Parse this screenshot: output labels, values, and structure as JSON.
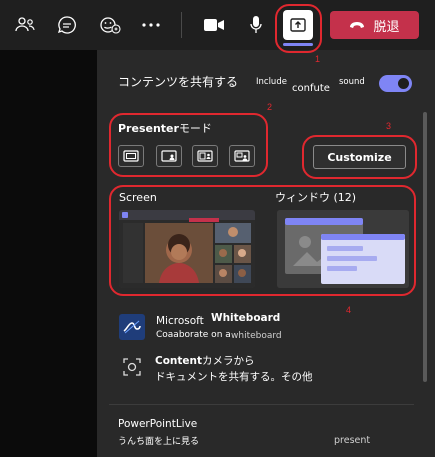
{
  "toolbar": {
    "icons": [
      "people-icon",
      "chat-icon",
      "react-icon",
      "more-icon",
      "camera-icon",
      "mic-icon",
      "share-tray-icon"
    ],
    "leave_label": "脱退"
  },
  "annotations": {
    "n1": "1",
    "n2": "2",
    "n3": "3",
    "n4": "4"
  },
  "share": {
    "heading": "コンテンツを共有する",
    "include_label": "Include",
    "include_sub": "confute",
    "sound_label": "sound",
    "sound_on": true,
    "presenter_bold": "Presenter",
    "presenter_mode": "モード",
    "presenter_modes": [
      "content-only",
      "standout",
      "side-by-side",
      "reporter"
    ],
    "customize_label": "Customize",
    "screen_label": "Screen",
    "window_label": "ウィンドウ (12)",
    "whiteboard_app": "Microsoft",
    "whiteboard_name": "Whiteboard",
    "whiteboard_sub_a": "Coaaborate on a",
    "whiteboard_sub_b": "whiteboard",
    "content_bold": "Content",
    "content_rest": "カメラから",
    "content_line2": "ドキュメントを共有する。その他",
    "powerpoint_label": "PowerPointLive",
    "powerpoint_sub": "うんち面を上に見る",
    "present_label": "present"
  },
  "colors": {
    "accent": "#7f85f5",
    "leave": "#c4314b",
    "annotation": "#e0282f"
  }
}
